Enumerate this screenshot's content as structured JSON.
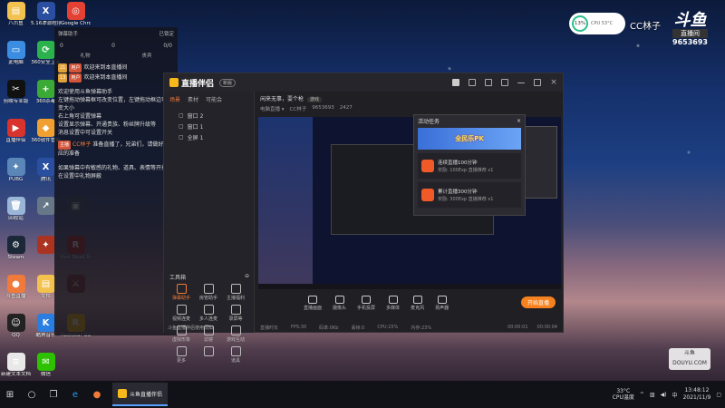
{
  "desktop_icons": [
    {
      "label": "八爪鱼",
      "color": "#f2c14e",
      "glyph": "▤",
      "icon": "folder-icon"
    },
    {
      "label": "5.16渗滤程序",
      "color": "#2a4fa0",
      "glyph": "X",
      "icon": "app-icon"
    },
    {
      "label": "Google Chrome",
      "color": "#e34133",
      "glyph": "◎",
      "icon": "chrome-icon"
    },
    {
      "label": "此电脑",
      "color": "#3a8de0",
      "glyph": "▭",
      "icon": "computer-icon"
    },
    {
      "label": "360安全卫士",
      "color": "#2bb24c",
      "glyph": "⟳",
      "icon": "360-security-icon"
    },
    {
      "label": "",
      "color": "transparent",
      "glyph": "",
      "icon": "blank-icon"
    },
    {
      "label": "剪映专业版",
      "color": "#111111",
      "glyph": "✂",
      "icon": "capcut-icon"
    },
    {
      "label": "360杀毒",
      "color": "#3aa935",
      "glyph": "+",
      "icon": "360-antivirus-icon"
    },
    {
      "label": "",
      "color": "transparent",
      "glyph": "",
      "icon": "blank-icon"
    },
    {
      "label": "直播伴侣",
      "color": "#d8332c",
      "glyph": "▶",
      "icon": "live-companion-icon"
    },
    {
      "label": "360软件管家",
      "color": "#f0a030",
      "glyph": "◆",
      "icon": "software-manager-icon"
    },
    {
      "label": "",
      "color": "transparent",
      "glyph": "",
      "icon": "blank-icon"
    },
    {
      "label": "PUBG",
      "color": "#5a86b8",
      "glyph": "✦",
      "icon": "game-icon"
    },
    {
      "label": "腾讯",
      "color": "#2a4fa0",
      "glyph": "X",
      "icon": "game-icon-2"
    },
    {
      "label": "",
      "color": "transparent",
      "glyph": "",
      "icon": "blank-icon"
    },
    {
      "label": "回收站",
      "color": "#9ab6d6",
      "glyph": "🗑",
      "icon": "recycle-bin-icon"
    },
    {
      "label": "",
      "color": "#667788",
      "glyph": "↗",
      "icon": "shortcut-icon"
    },
    {
      "label": "",
      "color": "#445566",
      "glyph": "▣",
      "icon": "app-icon-2"
    },
    {
      "label": "Steam",
      "color": "#1b2838",
      "glyph": "⚙",
      "icon": "steam-icon"
    },
    {
      "label": "",
      "color": "#aa3322",
      "glyph": "✦",
      "icon": "game-icon-3"
    },
    {
      "label": "Red Dead Redemption",
      "color": "#b22222",
      "glyph": "R",
      "icon": "rdr-icon"
    },
    {
      "label": "斗鱼直播",
      "color": "#f07a3a",
      "glyph": "●",
      "icon": "douyu-icon"
    },
    {
      "label": "文件",
      "color": "#f2c14e",
      "glyph": "▤",
      "icon": "folder-icon-2"
    },
    {
      "label": "",
      "color": "#883333",
      "glyph": "⚔",
      "icon": "game-icon-4"
    },
    {
      "label": "QQ",
      "color": "#222222",
      "glyph": "☺",
      "icon": "qq-icon"
    },
    {
      "label": "酷狗音乐",
      "color": "#2a7de1",
      "glyph": "K",
      "icon": "kugou-icon"
    },
    {
      "label": "Rockstar Games",
      "color": "#f5b800",
      "glyph": "R",
      "icon": "rockstar-icon"
    },
    {
      "label": "新建文本文档",
      "color": "#e8e8e8",
      "glyph": "≡",
      "icon": "text-document-icon"
    },
    {
      "label": "微信",
      "color": "#2dc100",
      "glyph": "✉",
      "icon": "wechat-icon"
    }
  ],
  "chat": {
    "header": "弹幕助手",
    "header_right": "已锁定",
    "stats": [
      "0",
      "0",
      "0/0"
    ],
    "tabs": [
      "礼物",
      "贵宾"
    ],
    "messages": [
      {
        "badge": "用户",
        "level": "21",
        "nick": "",
        "text": "欢迎来到本直播间"
      },
      {
        "badge": "用户",
        "level": "13",
        "nick": "",
        "text": "欢迎来到本直播间"
      }
    ],
    "system": "欢迎使用斗鱼弹幕助手\n左键拖动弹幕框可改变位置，左键拖动框边可改变大小\n右上角可设置弹幕\n设置显示弹幕、开通贵族、粉丝牌升级等\n消息设置中可设置开关",
    "streamer_msg_badge": "主播",
    "streamer_msg_nick": "CC林子",
    "streamer_msg": "准备直播了，兄弟们，请做好相应的准备",
    "footer": "如果弹幕中有敏感的礼物、道具、表情等开播后在设置中礼物屏蔽"
  },
  "window": {
    "app_name": "直播伴侣",
    "version": "新版",
    "left_tabs": [
      "场景",
      "素材",
      "可能会"
    ],
    "scenes": [
      "窗口 2",
      "窗口 1",
      "全屏 1"
    ],
    "tools_title": "工具箱",
    "tools": [
      {
        "label": "弹幕助手",
        "icon": "danmu-helper-icon"
      },
      {
        "label": "房管助手",
        "icon": "room-manager-icon"
      },
      {
        "label": "主播福利",
        "icon": "streamer-welfare-icon"
      },
      {
        "label": "视频连麦",
        "icon": "video-link-icon"
      },
      {
        "label": "多人连麦",
        "icon": "multi-link-icon"
      },
      {
        "label": "录屏等",
        "icon": "record-icon"
      },
      {
        "label": "虚拟形象",
        "icon": "avatar-virtual-icon"
      },
      {
        "label": "滤镜",
        "icon": "filter-icon"
      },
      {
        "label": "游戏互动",
        "icon": "game-interact-icon"
      },
      {
        "label": "更多",
        "icon": "more-icon"
      },
      {
        "label": "",
        "icon": "blank-tool-icon"
      },
      {
        "label": "道具",
        "icon": "props-icon"
      }
    ],
    "notice": "斗鱼直播伴侣使用须知",
    "room_title": "闲来无事，耍个枪",
    "room_tag": "游戏",
    "room_meta": [
      "电脑直播 ▾",
      "CC林子",
      "9653693",
      "2427"
    ],
    "controls": [
      "直播画面",
      "摄像头",
      "手机投屏",
      "多媒体",
      "麦克风",
      "扬声器"
    ],
    "start_button": "开始直播",
    "status": [
      "直播时长",
      "FPS:30",
      "码率:0Kb",
      "丢帧:0",
      "CPU:15%",
      "内存:23%",
      "00:00:01",
      "00:00:04"
    ]
  },
  "popup": {
    "title": "活动任务",
    "banner": "全民乐PK",
    "tasks": [
      {
        "title": "连续直播100分钟",
        "sub": "奖励: 100Exp 直播推荐 x1"
      },
      {
        "title": "累计直播300分钟",
        "sub": "奖励: 300Exp 直播推荐 x1"
      }
    ]
  },
  "overlay": {
    "cpu_percent": "13%",
    "cpu_temp": "CPU 53°C",
    "anchor": "CC林子",
    "douyu_logo": "斗鱼",
    "douyu_sub": "直播间",
    "room_id": "9653693",
    "watermark_top": "斗鱼",
    "watermark_bottom": "DOUYU.COM"
  },
  "taskbar": {
    "app": "斗鱼直播伴侣",
    "temp_line1": "33°C",
    "temp_line2": "CPU温度",
    "ime": "中",
    "time": "13:48:12",
    "date": "2021/11/9"
  }
}
